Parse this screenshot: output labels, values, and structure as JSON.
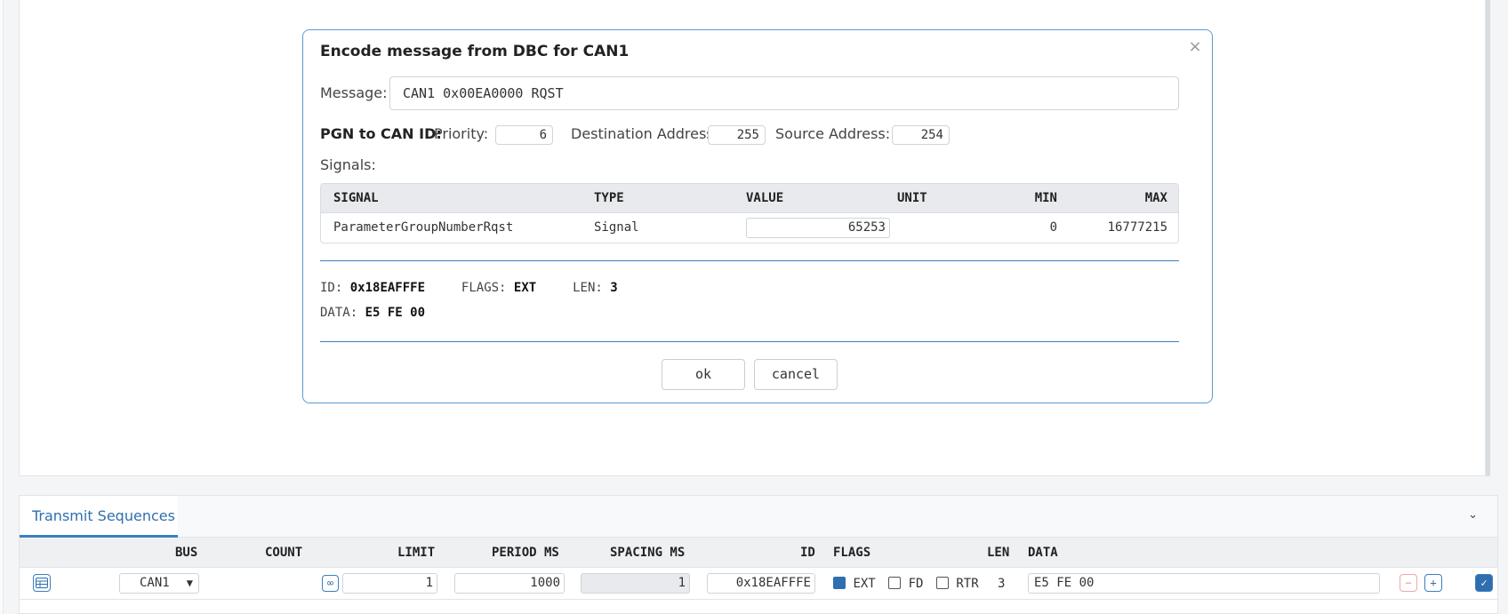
{
  "modal": {
    "title": "Encode message from DBC for CAN1",
    "close_glyph": "×",
    "message_label": "Message:",
    "message_value": "CAN1 0x00EA0000 RQST",
    "pgn_title": "PGN to CAN ID:",
    "priority_label": "Priority:",
    "priority_value": "6",
    "dest_label": "Destination Address:",
    "dest_value": "255",
    "src_label": "Source Address:",
    "src_value": "254",
    "signals_label": "Signals:",
    "signals_table": {
      "headers": [
        "SIGNAL",
        "TYPE",
        "VALUE",
        "UNIT",
        "MIN",
        "MAX"
      ],
      "rows": [
        {
          "signal": "ParameterGroupNumberRqst",
          "type": "Signal",
          "value": "65253",
          "unit": "",
          "min": "0",
          "max": "16777215"
        }
      ]
    },
    "result": {
      "id_label": "ID:",
      "id_value": "0x18EAFFFE",
      "flags_label": "FLAGS:",
      "flags_value": "EXT",
      "len_label": "LEN:",
      "len_value": "3",
      "data_label": "DATA:",
      "data_value": "E5 FE 00"
    },
    "ok_label": "ok",
    "cancel_label": "cancel"
  },
  "transmit": {
    "tab_label": "Transmit Sequences",
    "collapse_glyph": "⌄",
    "headers": {
      "bus": "BUS",
      "count": "COUNT",
      "limit": "LIMIT",
      "period": "PERIOD MS",
      "spacing": "SPACING MS",
      "id": "ID",
      "flags": "FLAGS",
      "len": "LEN",
      "data": "DATA"
    },
    "row": {
      "bus": "CAN1",
      "infinity_glyph": "∞",
      "limit": "1",
      "period": "1000",
      "spacing": "1",
      "id": "0x18EAFFFE",
      "flag_ext": "EXT",
      "flag_fd": "FD",
      "flag_rtr": "RTR",
      "len": "3",
      "data": "E5 FE 00",
      "remove_glyph": "−",
      "add_glyph": "+"
    }
  },
  "colors": {
    "accent": "#3b7fc0",
    "header_bg": "#e8eaed"
  }
}
